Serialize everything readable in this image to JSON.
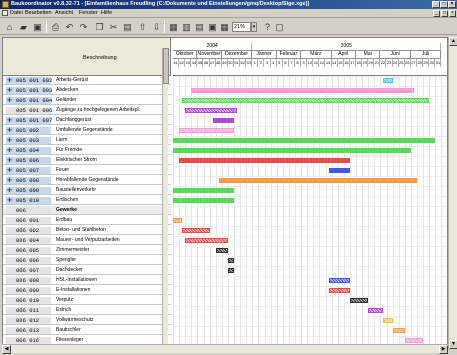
{
  "window": {
    "title": "Baukoordinator v0.8.32-71 - [Einfamilienhaus Freudling (C:/Dokumente und Einstellungen/gmq/Desktop/Sige.xge)]",
    "minimize_label": "_",
    "maximize_label": "□",
    "close_label": "×"
  },
  "menu": {
    "items": [
      "Datei",
      "Bearbeiten",
      "Ansicht",
      "Fenster",
      "Hilfe"
    ]
  },
  "toolbar": {
    "zoom_value": "21%",
    "zoom_arrow": "▾"
  },
  "table": {
    "column_header": "Beschreibung",
    "rows": [
      {
        "code": "005 001 002",
        "desc": "Arbeits-Gerüst",
        "icon": true,
        "bold": false
      },
      {
        "code": "005 001 003",
        "desc": "Abdecken",
        "icon": true,
        "bold": false
      },
      {
        "code": "005 001 004",
        "desc": "Geländer",
        "icon": true,
        "bold": false
      },
      {
        "code": "005 001 006",
        "desc": "Zugänge zu hochgelegenen Arbeitspl.",
        "icon": false,
        "bold": false
      },
      {
        "code": "005 001 007",
        "desc": "Dachfanggerüst",
        "icon": true,
        "bold": false
      },
      {
        "code": "005 002",
        "desc": "Umfallende Gegenstände",
        "icon": true,
        "bold": false
      },
      {
        "code": "005 003",
        "desc": "Lärm",
        "icon": true,
        "bold": false
      },
      {
        "code": "005 004",
        "desc": "Für Fremde",
        "icon": true,
        "bold": false
      },
      {
        "code": "005 006",
        "desc": "Elektrischer Strom",
        "icon": true,
        "bold": false
      },
      {
        "code": "005 007",
        "desc": "Feuer",
        "icon": true,
        "bold": false
      },
      {
        "code": "005 008",
        "desc": "Herabfallende Gegenstände",
        "icon": true,
        "bold": false
      },
      {
        "code": "005 009",
        "desc": "Baustellenverkehr",
        "icon": true,
        "bold": false
      },
      {
        "code": "005 010",
        "desc": "Erdischen",
        "icon": true,
        "bold": false
      },
      {
        "code": "006",
        "desc": "Gewerke",
        "icon": false,
        "bold": true
      },
      {
        "code": "006 001",
        "desc": "Erdbau",
        "icon": false,
        "bold": false
      },
      {
        "code": "006 002",
        "desc": "Beton- und Stahlbeton",
        "icon": false,
        "bold": false
      },
      {
        "code": "006 004",
        "desc": "Maurer- und Verputzarbeiten",
        "icon": false,
        "bold": false
      },
      {
        "code": "006 005",
        "desc": "Zimmermeister",
        "icon": false,
        "bold": false
      },
      {
        "code": "006 006",
        "desc": "Spengler",
        "icon": false,
        "bold": false
      },
      {
        "code": "006 007",
        "desc": "Dachdecker",
        "icon": false,
        "bold": false
      },
      {
        "code": "006 008",
        "desc": "HSL-Installationen",
        "icon": false,
        "bold": false
      },
      {
        "code": "006 009",
        "desc": "E-Installationen",
        "icon": false,
        "bold": false
      },
      {
        "code": "006 010",
        "desc": "Verputz",
        "icon": false,
        "bold": false
      },
      {
        "code": "006 011",
        "desc": "Estrich",
        "icon": false,
        "bold": false
      },
      {
        "code": "006 012",
        "desc": "Vollwärmeschutz",
        "icon": false,
        "bold": false
      },
      {
        "code": "006 013",
        "desc": "Bautischler",
        "icon": false,
        "bold": false
      },
      {
        "code": "006 016",
        "desc": "Fliesenleger",
        "icon": false,
        "bold": false
      }
    ]
  },
  "timeline": {
    "years": [
      "2004",
      "2005"
    ],
    "months": [
      "Oktober",
      "November",
      "Dezember",
      "Jänner",
      "Februar",
      "März",
      "April",
      "Mai",
      "Juni",
      "Juli"
    ],
    "weeks": [
      "41",
      "42",
      "43",
      "44",
      "45",
      "46",
      "47",
      "48",
      "49",
      "50",
      "51",
      "52",
      "53",
      "1",
      "2",
      "3",
      "4",
      "5",
      "6",
      "7",
      "8",
      "9",
      "10",
      "11",
      "12",
      "13",
      "14",
      "15",
      "16",
      "17",
      "18",
      "19",
      "20",
      "21",
      "22",
      "23",
      "24",
      "25",
      "26",
      "27",
      "28",
      "29",
      "30",
      "31"
    ]
  },
  "colors": {
    "green": "#5ad85a",
    "pink": "#ff9ad2",
    "violet": "#b04ad8",
    "red": "#ee4a4a",
    "blue": "#3f5ae8",
    "orange": "#ff9a4a",
    "cyan": "#4ac8e8",
    "black": "#303030",
    "yellow": "#e8c84a"
  },
  "gantt": {
    "bars": [
      {
        "row": 0,
        "start": 34.5,
        "end": 36,
        "color": "cyan",
        "hatch": true
      },
      {
        "row": 1,
        "start": 3,
        "end": 39.5,
        "color": "pink",
        "hatch": false
      },
      {
        "row": 2,
        "start": 1.5,
        "end": 42,
        "color": "green",
        "hatch": true
      },
      {
        "row": 3,
        "start": 2,
        "end": 10.5,
        "color": "violet",
        "hatch": true
      },
      {
        "row": 4,
        "start": 6.5,
        "end": 10,
        "color": "violet",
        "hatch": false
      },
      {
        "row": 5,
        "start": 1,
        "end": 10,
        "color": "pink",
        "hatch": true
      },
      {
        "row": 6,
        "start": 0,
        "end": 43,
        "color": "green",
        "hatch": false
      },
      {
        "row": 7,
        "start": 0,
        "end": 39,
        "color": "green",
        "hatch": false
      },
      {
        "row": 8,
        "start": 1,
        "end": 29,
        "color": "red",
        "hatch": false
      },
      {
        "row": 9,
        "start": 25.5,
        "end": 29,
        "color": "blue",
        "hatch": false
      },
      {
        "row": 10,
        "start": 7.5,
        "end": 40,
        "color": "orange",
        "hatch": false
      },
      {
        "row": 11,
        "start": 0,
        "end": 10,
        "color": "green",
        "hatch": false
      },
      {
        "row": 12,
        "start": 0,
        "end": 10,
        "color": "green",
        "hatch": false
      },
      {
        "row": 14,
        "start": 0,
        "end": 1.5,
        "color": "orange",
        "hatch": true
      },
      {
        "row": 15,
        "start": 1.5,
        "end": 6,
        "color": "red",
        "hatch": true
      },
      {
        "row": 16,
        "start": 2,
        "end": 9,
        "color": "red",
        "hatch": true
      },
      {
        "row": 17,
        "start": 7,
        "end": 9,
        "color": "black",
        "hatch": true
      },
      {
        "row": 18,
        "start": 9,
        "end": 10,
        "color": "black",
        "hatch": true
      },
      {
        "row": 19,
        "start": 9,
        "end": 10,
        "color": "black",
        "hatch": true
      },
      {
        "row": 20,
        "start": 25.5,
        "end": 29,
        "color": "blue",
        "hatch": true
      },
      {
        "row": 21,
        "start": 25.5,
        "end": 29,
        "color": "red",
        "hatch": true
      },
      {
        "row": 22,
        "start": 29,
        "end": 32,
        "color": "black",
        "hatch": true
      },
      {
        "row": 23,
        "start": 32,
        "end": 34.5,
        "color": "violet",
        "hatch": true
      },
      {
        "row": 24,
        "start": 34.5,
        "end": 36,
        "color": "yellow",
        "hatch": true
      },
      {
        "row": 25,
        "start": 36,
        "end": 38,
        "color": "orange",
        "hatch": true
      },
      {
        "row": 26,
        "start": 38,
        "end": 41,
        "color": "pink",
        "hatch": true
      }
    ]
  }
}
